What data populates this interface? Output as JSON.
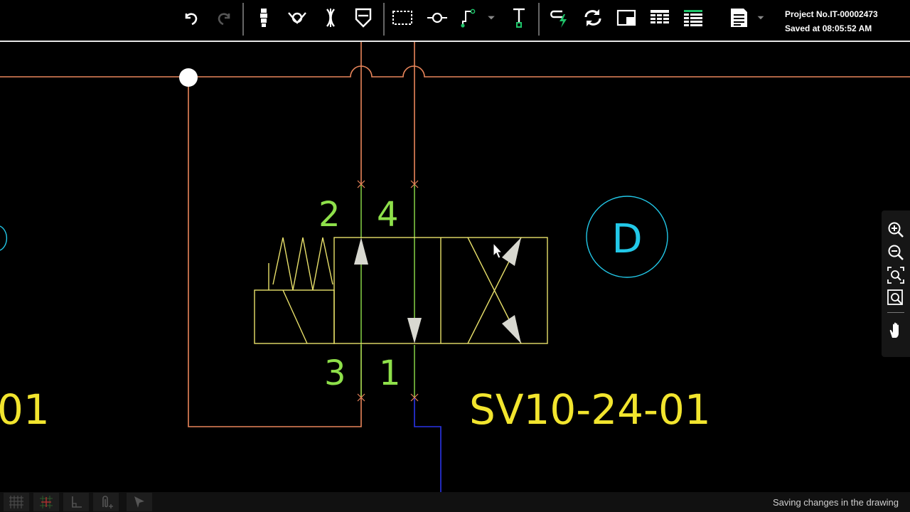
{
  "header": {
    "project_no": "Project No.IT-00002473",
    "saved_at": "Saved at 08:05:52 AM"
  },
  "toolbar": {
    "buttons": [
      "undo-icon",
      "redo-icon",
      "cartridge-icon",
      "check-valve-icon",
      "orifice-icon",
      "cylinder-icon",
      "select-rectangle-icon",
      "node-icon",
      "line-route-icon",
      "text-icon",
      "connect-icon",
      "refresh-icon",
      "frame-icon",
      "table-icon",
      "list-table-icon",
      "report-icon"
    ]
  },
  "drawing": {
    "port_labels": [
      "2",
      "4",
      "3",
      "1"
    ],
    "component_label": "SV10-24-01",
    "left_label_partial": "01",
    "detail_marker": "D",
    "colors": {
      "line_orange": "#e8855a",
      "port_green": "#8ee04a",
      "symbol_yellow": "#e8e06a",
      "label_yellow": "#f2e52e",
      "marker_cyan": "#22c8e8",
      "line_blue": "#2a34e8"
    }
  },
  "status": {
    "text": "Saving changes in the drawing"
  }
}
